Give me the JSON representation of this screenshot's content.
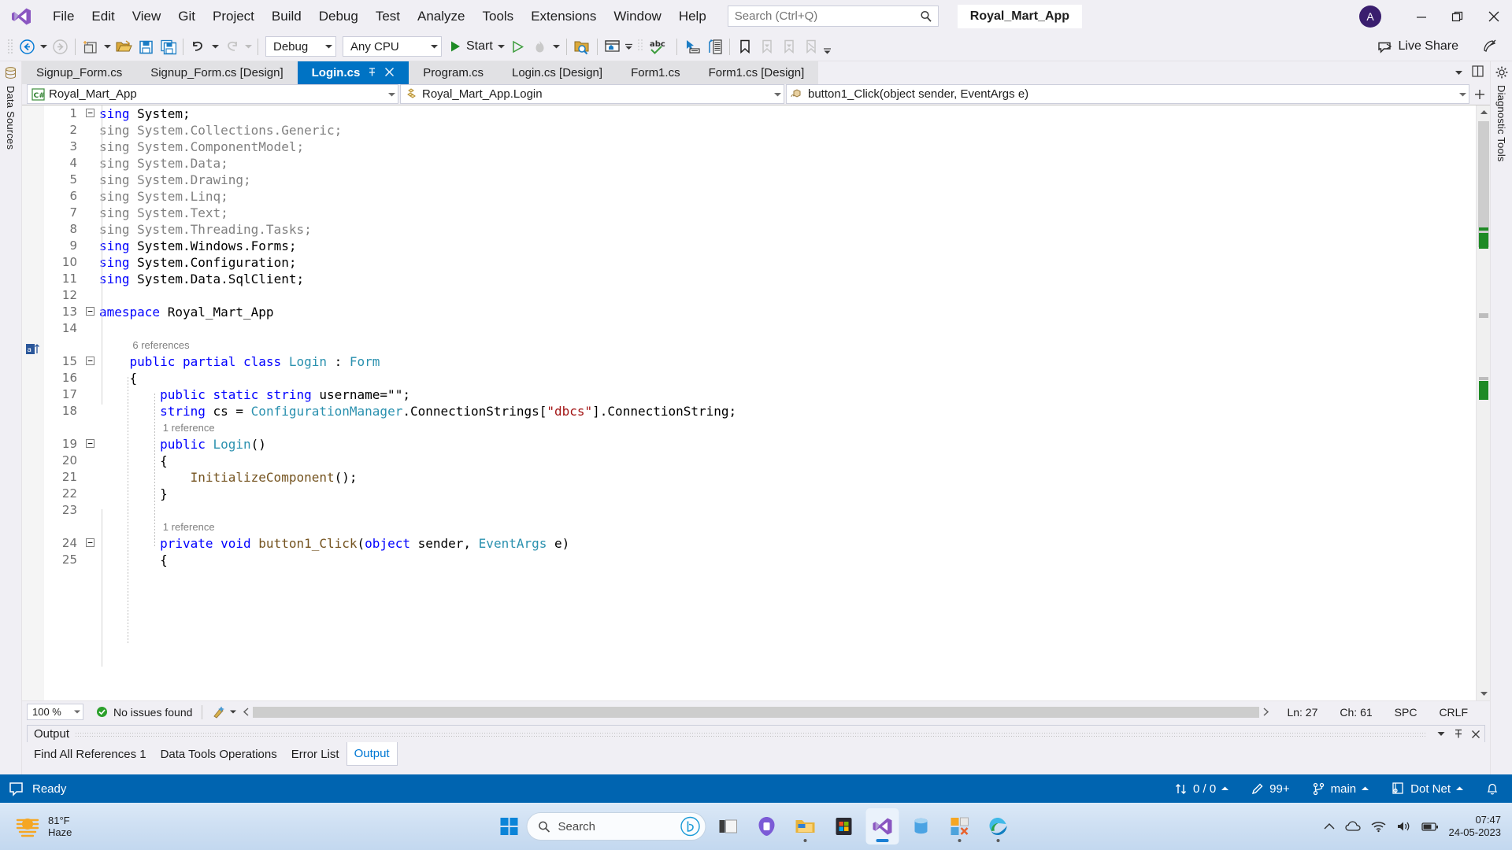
{
  "titlebar": {
    "logo_icon": "visual-studio-logo-icon",
    "menus": [
      "File",
      "Edit",
      "View",
      "Git",
      "Project",
      "Build",
      "Debug",
      "Test",
      "Analyze",
      "Tools",
      "Extensions",
      "Window",
      "Help"
    ],
    "search_placeholder": "Search (Ctrl+Q)",
    "search_value": "",
    "search_icon": "magnifier-icon",
    "solution_name": "Royal_Mart_App",
    "avatar_initial": "A",
    "minimize_icon": "minimize-icon",
    "restore_icon": "restore-icon",
    "close_icon": "close-icon"
  },
  "toolbar": {
    "navigate_back_icon": "navigate-back-icon",
    "navigate_forward_icon": "navigate-forward-icon",
    "new_item_icon": "new-item-icon",
    "open_file_icon": "open-file-icon",
    "save_icon": "save-icon",
    "save_all_icon": "save-all-icon",
    "undo_icon": "undo-icon",
    "redo_icon": "redo-icon",
    "configuration": "Debug",
    "platform": "Any CPU",
    "start_label": "Start",
    "start_icon": "start-play-icon",
    "start_without_debug_icon": "start-without-debugging-icon",
    "hot_reload_icon": "hot-reload-icon",
    "solution_explorer_icon": "search-solution-explorer-icon",
    "window_layout_icon": "window-layout-icon",
    "spell_check_icon": "spell-check-abc-icon",
    "select_element_icon": "select-element-icon",
    "toolbar_extra_icon": "live-property-explorer-icon",
    "bookmark_icon": "bookmark-icon",
    "prev_bookmark_icon": "previous-bookmark-icon",
    "next_bookmark_icon": "next-bookmark-icon",
    "clear_bookmarks_icon": "clear-bookmarks-icon",
    "overflow_icon": "toolbar-overflow-icon",
    "live_share_label": "Live Share",
    "live_share_icon": "live-share-icon",
    "feedback_icon": "send-feedback-icon"
  },
  "left_rail": {
    "label": "Data Sources",
    "icon": "data-sources-icon"
  },
  "right_rail": {
    "label": "Diagnostic Tools",
    "settings_icon": "gear-icon"
  },
  "tabs": {
    "items": [
      {
        "label": "Signup_Form.cs",
        "active": false
      },
      {
        "label": "Signup_Form.cs [Design]",
        "active": false
      },
      {
        "label": "Login.cs",
        "active": true,
        "pin_icon": "pin-icon",
        "close_icon": "close-tab-icon"
      },
      {
        "label": "Program.cs",
        "active": false
      },
      {
        "label": "Login.cs [Design]",
        "active": false
      },
      {
        "label": "Form1.cs",
        "active": false
      },
      {
        "label": "Form1.cs [Design]",
        "active": false
      }
    ],
    "dropdown_icon": "tab-list-dropdown-icon",
    "vertical_split_icon": "vertical-split-icon"
  },
  "navbar": {
    "project": "Royal_Mart_App",
    "project_icon": "csharp-project-icon",
    "type": "Royal_Mart_App.Login",
    "type_icon": "class-icon",
    "member": "button1_Click(object sender, EventArgs e)",
    "member_icon": "method-icon",
    "expand_icon": "expand-editor-icon",
    "dropdown_icon": "chevron-down-icon"
  },
  "editor": {
    "lines": [
      {
        "num": "1",
        "fold": "minus",
        "tokens": [
          [
            "kw",
            "sing "
          ],
          [
            "id",
            "System;"
          ]
        ]
      },
      {
        "num": "2",
        "tokens": [
          [
            "fade",
            "sing System.Collections.Generic;"
          ]
        ]
      },
      {
        "num": "3",
        "tokens": [
          [
            "fade",
            "sing System.ComponentModel;"
          ]
        ]
      },
      {
        "num": "4",
        "tokens": [
          [
            "fade",
            "sing System.Data;"
          ]
        ]
      },
      {
        "num": "5",
        "tokens": [
          [
            "fade",
            "sing System.Drawing;"
          ]
        ]
      },
      {
        "num": "6",
        "tokens": [
          [
            "fade",
            "sing System.Linq;"
          ]
        ]
      },
      {
        "num": "7",
        "tokens": [
          [
            "fade",
            "sing System.Text;"
          ]
        ]
      },
      {
        "num": "8",
        "tokens": [
          [
            "fade",
            "sing System.Threading.Tasks;"
          ]
        ]
      },
      {
        "num": "9",
        "tokens": [
          [
            "kw",
            "sing "
          ],
          [
            "id",
            "System.Windows.Forms;"
          ]
        ]
      },
      {
        "num": "10",
        "tokens": [
          [
            "kw",
            "sing "
          ],
          [
            "id",
            "System.Configuration;"
          ]
        ]
      },
      {
        "num": "11",
        "tokens": [
          [
            "kw",
            "sing "
          ],
          [
            "id",
            "System.Data.SqlClient;"
          ]
        ]
      },
      {
        "num": "12",
        "tokens": [
          [
            "id",
            ""
          ]
        ]
      },
      {
        "num": "13",
        "fold": "minus",
        "tokens": [
          [
            "kw",
            "amespace "
          ],
          [
            "id",
            "Royal_Mart_App"
          ]
        ]
      },
      {
        "num": "14",
        "tokens": [
          [
            "id",
            ""
          ]
        ]
      },
      {
        "num": "",
        "ref": "6 references",
        "indent": 4
      },
      {
        "num": "15",
        "fold": "minus",
        "tokens": [
          [
            "id",
            "    "
          ],
          [
            "kw",
            "public partial class "
          ],
          [
            "ty",
            "Login"
          ],
          [
            "id",
            " : "
          ],
          [
            "ty",
            "Form"
          ]
        ]
      },
      {
        "num": "16",
        "tokens": [
          [
            "id",
            "    {"
          ]
        ]
      },
      {
        "num": "17",
        "tokens": [
          [
            "id",
            "        "
          ],
          [
            "kw",
            "public static string "
          ],
          [
            "id",
            "username=\"\";"
          ]
        ]
      },
      {
        "num": "18",
        "tokens": [
          [
            "id",
            "        "
          ],
          [
            "kw",
            "string "
          ],
          [
            "id",
            "cs = "
          ],
          [
            "ty",
            "ConfigurationManager"
          ],
          [
            "id",
            ".ConnectionStrings["
          ],
          [
            "str",
            "\"dbcs\""
          ],
          [
            "id",
            "].ConnectionString;"
          ]
        ]
      },
      {
        "num": "",
        "ref": "1 reference",
        "indent": 8
      },
      {
        "num": "19",
        "fold": "minus",
        "tokens": [
          [
            "id",
            "        "
          ],
          [
            "kw",
            "public "
          ],
          [
            "ty",
            "Login"
          ],
          [
            "id",
            "()"
          ]
        ]
      },
      {
        "num": "20",
        "tokens": [
          [
            "id",
            "        {"
          ]
        ]
      },
      {
        "num": "21",
        "tokens": [
          [
            "id",
            "            "
          ],
          [
            "mth",
            "InitializeComponent"
          ],
          [
            "id",
            "();"
          ]
        ]
      },
      {
        "num": "22",
        "tokens": [
          [
            "id",
            "        }"
          ]
        ]
      },
      {
        "num": "23",
        "tokens": [
          [
            "id",
            ""
          ]
        ]
      },
      {
        "num": "",
        "ref": "1 reference",
        "indent": 8
      },
      {
        "num": "24",
        "fold": "minus",
        "tokens": [
          [
            "id",
            "        "
          ],
          [
            "kw",
            "private void "
          ],
          [
            "mth",
            "button1_Click"
          ],
          [
            "id",
            "("
          ],
          [
            "kw",
            "object "
          ],
          [
            "id",
            "sender, "
          ],
          [
            "ty",
            "EventArgs"
          ],
          [
            "id",
            " e)"
          ]
        ]
      },
      {
        "num": "25",
        "tokens": [
          [
            "id",
            "        {"
          ]
        ]
      }
    ],
    "bookmark_glyph_line": "15",
    "bookmark_glyph_icon": "bookmark-glyph-icon"
  },
  "editor_status": {
    "zoom": "100 %",
    "issues_text": "No issues found",
    "issues_icon": "ok-check-icon",
    "quickactions_icon": "quick-actions-icon",
    "line": "Ln: 27",
    "column": "Ch: 61",
    "spaces": "SPC",
    "line_endings": "CRLF"
  },
  "output_pane": {
    "title": "Output",
    "dropdown_icon": "chevron-down-icon",
    "pin_icon": "pin-icon",
    "close_icon": "close-icon",
    "tabs": [
      {
        "label": "Find All References 1",
        "active": false
      },
      {
        "label": "Data Tools Operations",
        "active": false
      },
      {
        "label": "Error List",
        "active": false
      },
      {
        "label": "Output",
        "active": true
      }
    ]
  },
  "vs_status": {
    "ready_text": "Ready",
    "ready_icon": "ready-notify-icon",
    "source_control_count": "0 / 0",
    "source_control_icon": "updown-arrows-icon",
    "pending_changes": "99+",
    "pending_changes_icon": "pencil-icon",
    "branch": "main",
    "branch_icon": "git-branch-icon",
    "repo": "Dot Net",
    "repo_icon": "repository-icon",
    "notifications_icon": "bell-icon",
    "accent_color": "#0064B0"
  },
  "taskbar": {
    "weather_temp": "81°F",
    "weather_cond": "Haze",
    "weather_icon": "haze-sun-icon",
    "start_icon": "windows-start-icon",
    "search_placeholder": "Search",
    "search_icon": "magnifier-icon",
    "copilot_icon": "bing-copilot-icon",
    "apps": [
      {
        "name": "task-view-icon",
        "state": "none"
      },
      {
        "name": "teams-icon",
        "state": "none"
      },
      {
        "name": "file-explorer-icon",
        "state": "open"
      },
      {
        "name": "microsoft-store-icon",
        "state": "none"
      },
      {
        "name": "visual-studio-icon",
        "state": "active"
      },
      {
        "name": "sql-server-management-studio-icon",
        "state": "none"
      },
      {
        "name": "xampp-icon",
        "state": "open"
      },
      {
        "name": "microsoft-edge-icon",
        "state": "open"
      }
    ],
    "tray": {
      "chevron_icon": "show-hidden-icons-icon",
      "onedrive_icon": "onedrive-icon",
      "wifi_icon": "wifi-icon",
      "volume_icon": "volume-icon",
      "battery_icon": "battery-icon"
    },
    "time": "07:47",
    "date": "24-05-2023"
  }
}
